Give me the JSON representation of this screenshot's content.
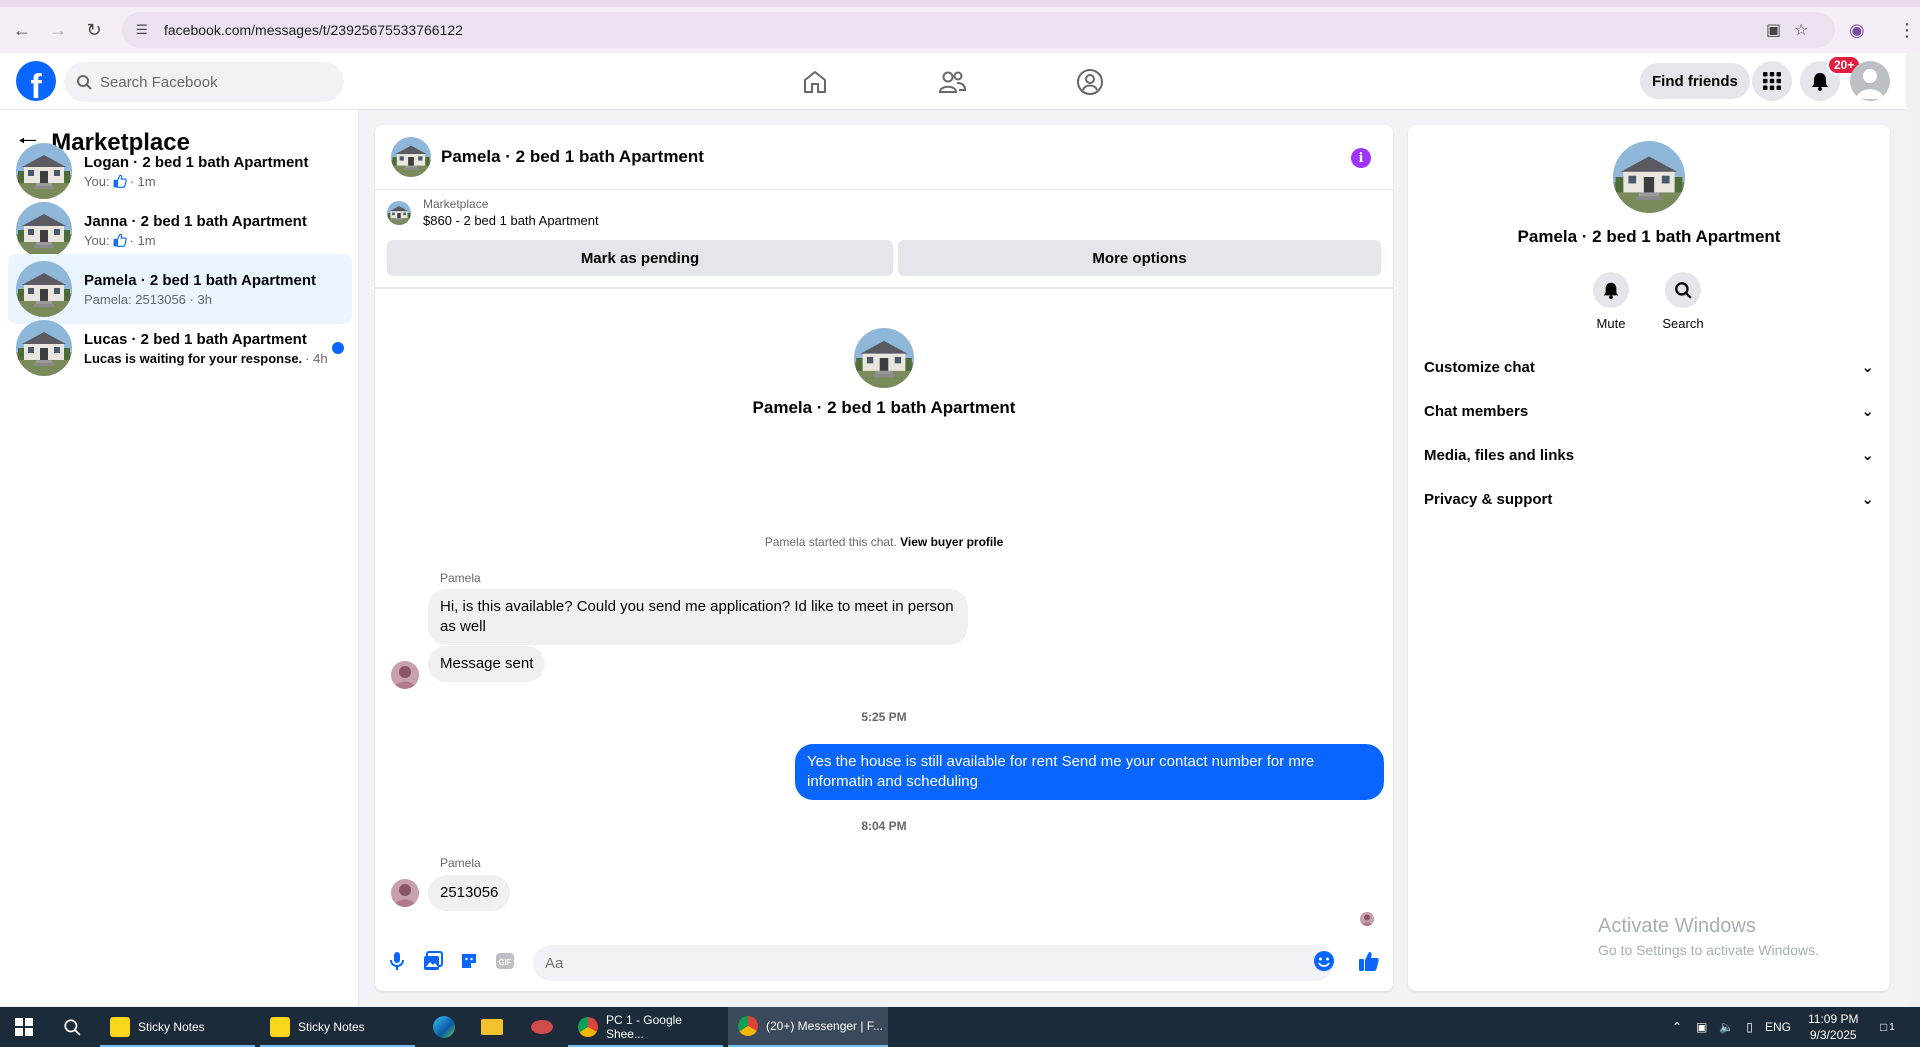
{
  "browser": {
    "url": "facebook.com/messages/t/23925675533766122"
  },
  "header": {
    "logo_letter": "f",
    "search_placeholder": "Search Facebook",
    "find_friends": "Find friends",
    "notification_badge": "20+"
  },
  "sidebar": {
    "title": "Marketplace",
    "conversations": [
      {
        "name": "Logan · 2 bed 1 bath Apartment",
        "prefix": "You:",
        "suffix": "· 1m",
        "active": false,
        "unread": false
      },
      {
        "name": "Janna · 2 bed 1 bath Apartment",
        "prefix": "You:",
        "suffix": "· 1m",
        "active": false,
        "unread": false
      },
      {
        "name": "Pamela · 2 bed 1 bath Apartment",
        "subtitle": "Pamela: 2513056 · 3h",
        "active": true,
        "unread": false
      },
      {
        "name": "Lucas · 2 bed 1 bath Apartment",
        "subtitle": "Lucas is waiting for your response.",
        "suffix": "· 4h",
        "active": false,
        "unread": true
      }
    ]
  },
  "chat": {
    "title": "Pamela · 2 bed 1 bath Apartment",
    "listing_label": "Marketplace",
    "listing_detail": "$860 - 2 bed 1 bath Apartment",
    "mark_pending": "Mark as pending",
    "more_options": "More options",
    "profile_name": "Pamela · 2 bed 1 bath Apartment",
    "started_text": "Pamela started this chat.",
    "view_buyer": "View buyer profile",
    "messages": [
      {
        "sender": "Pamela",
        "text": "Hi, is this available?  Could you send me application?  Id like to meet in person as well"
      },
      {
        "text": "Message sent"
      },
      {
        "time": "5:25 PM"
      },
      {
        "me": true,
        "text": "Yes the house is still available for rent Send me your contact number for mre informatin and  scheduling"
      },
      {
        "time": "8:04 PM"
      },
      {
        "sender": "Pamela",
        "text": "2513056"
      }
    ],
    "composer_placeholder": "Aa"
  },
  "details": {
    "name": "Pamela · 2 bed 1 bath Apartment",
    "mute": "Mute",
    "search": "Search",
    "sections": [
      "Customize chat",
      "Chat members",
      "Media, files and links",
      "Privacy & support"
    ]
  },
  "watermark": {
    "line1": "Activate Windows",
    "line2": "Go to Settings to activate Windows."
  },
  "taskbar": {
    "items": [
      "Sticky Notes",
      "Sticky Notes",
      "PC 1 - Google Shee...",
      "(20+) Messenger | F..."
    ],
    "lang": "ENG",
    "time": "11:09 PM",
    "date": "9/3/2025",
    "notif_count": "1"
  },
  "colors": {
    "fb_blue": "#0866ff",
    "info_purple": "#a033ff",
    "badge_red": "#e41e3f"
  }
}
